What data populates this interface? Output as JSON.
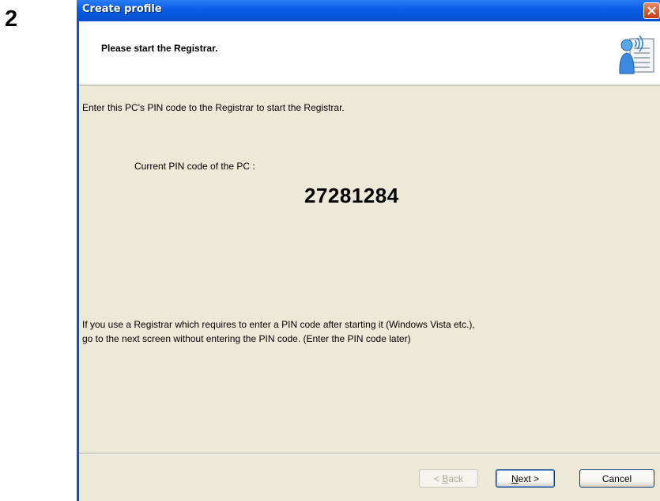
{
  "step_number": "2",
  "window": {
    "title": "Create profile",
    "header": "Please start the Registrar.",
    "header_icon": "person-signal-document-icon"
  },
  "content": {
    "intro": "Enter this PC's PIN code to the Registrar to start the Registrar.",
    "pin_label": "Current PIN code of the PC :",
    "pin_value": "27281284",
    "note_line1": "If you use a Registrar which requires to enter a PIN code after starting it (Windows Vista etc.),",
    "note_line2": "go to the next screen without entering the PIN code. (Enter the PIN code later)"
  },
  "buttons": {
    "back": {
      "before": "< ",
      "accel": "B",
      "after": "ack"
    },
    "next": {
      "accel": "N",
      "after": "ext >"
    },
    "cancel": "Cancel"
  },
  "colors": {
    "titlebar": "#0a4fd8",
    "dialog_bg": "#ece9d8",
    "close_button": "#d9552f"
  }
}
